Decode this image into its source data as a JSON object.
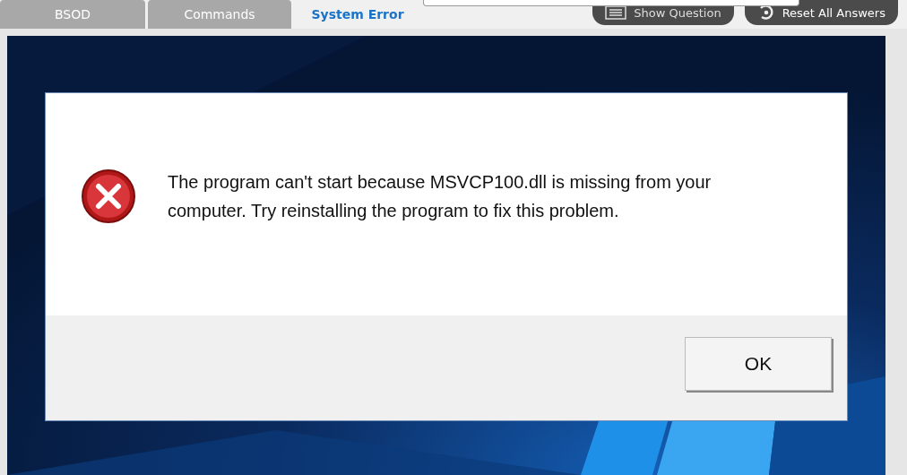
{
  "tabs": [
    {
      "label": "BSOD",
      "selected": false
    },
    {
      "label": "Commands",
      "selected": false
    },
    {
      "label": "System Error",
      "selected": true
    }
  ],
  "toolbar": [
    {
      "label": "Show Question",
      "kind": "question"
    },
    {
      "label": "Reset All Answers",
      "kind": "reset"
    }
  ],
  "dialog": {
    "message": "The program can't start because MSVCP100.dll is missing from your computer. Try reinstalling the program to fix this problem.",
    "button": "OK"
  }
}
